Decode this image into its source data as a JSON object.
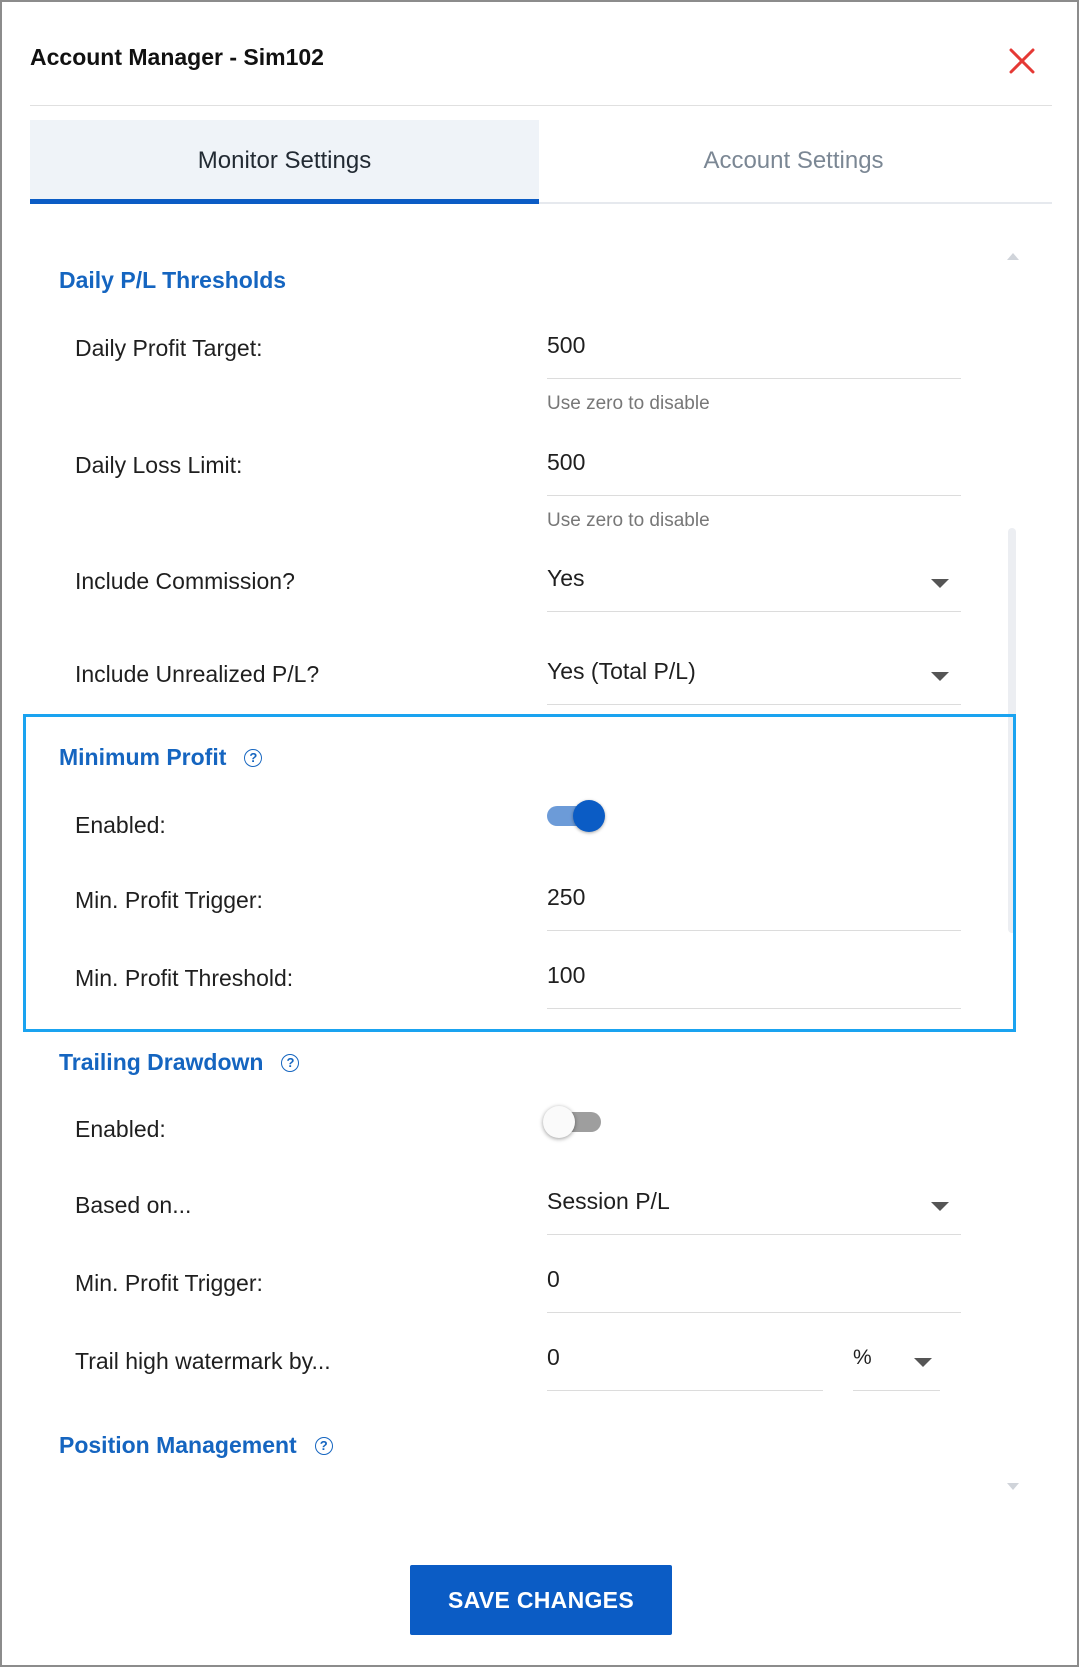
{
  "dialog": {
    "title": "Account Manager - Sim102"
  },
  "tabs": [
    {
      "label": "Monitor Settings",
      "active": true
    },
    {
      "label": "Account Settings",
      "active": false
    }
  ],
  "daily_pl": {
    "title": "Daily P/L Thresholds",
    "profit_target": {
      "label": "Daily Profit Target:",
      "value": "500",
      "hint": "Use zero to disable"
    },
    "loss_limit": {
      "label": "Daily Loss Limit:",
      "value": "500",
      "hint": "Use zero to disable"
    },
    "include_commission": {
      "label": "Include Commission?",
      "value": "Yes"
    },
    "include_unrealized": {
      "label": "Include Unrealized P/L?",
      "value": "Yes (Total P/L)"
    }
  },
  "min_profit": {
    "title": "Minimum Profit",
    "help": "?",
    "enabled": {
      "label": "Enabled:",
      "on": true
    },
    "trigger": {
      "label": "Min. Profit Trigger:",
      "value": "250"
    },
    "threshold": {
      "label": "Min. Profit Threshold:",
      "value": "100"
    }
  },
  "trailing": {
    "title": "Trailing Drawdown",
    "help": "?",
    "enabled": {
      "label": "Enabled:",
      "on": false
    },
    "based_on": {
      "label": "Based on...",
      "value": "Session P/L"
    },
    "trigger": {
      "label": "Min. Profit Trigger:",
      "value": "0"
    },
    "watermark": {
      "label": "Trail high watermark by...",
      "value": "0",
      "unit": "%"
    }
  },
  "position_mgmt": {
    "title": "Position Management",
    "help": "?"
  },
  "footer": {
    "save_label": "SAVE CHANGES"
  },
  "colors": {
    "accent": "#0b5cc5",
    "section_title": "#1565c0",
    "highlight": "#1aa3f0",
    "close": "#e53935"
  }
}
